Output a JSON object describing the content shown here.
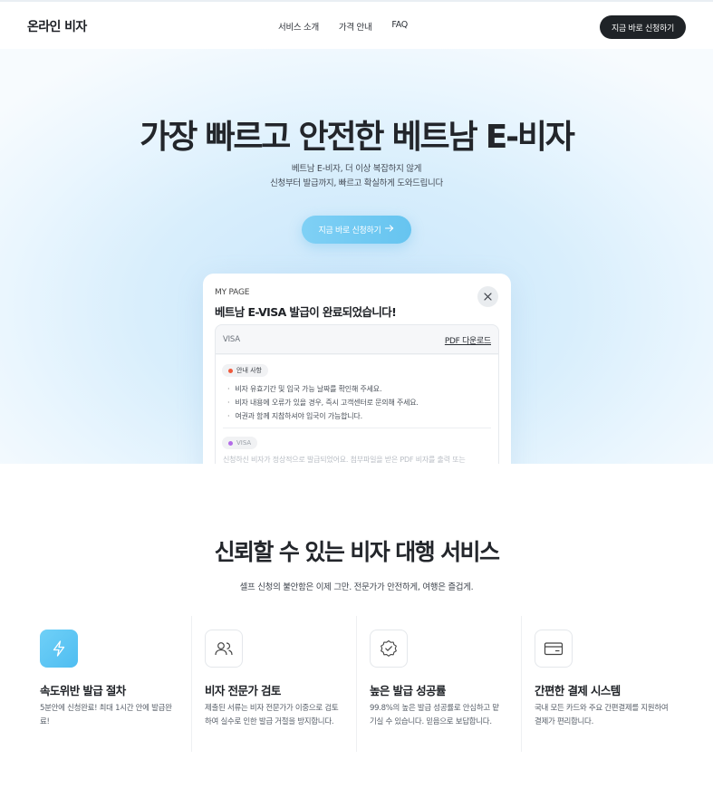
{
  "header": {
    "logo": "온라인 비자",
    "nav": [
      "서비스 소개",
      "가격 안내",
      "FAQ"
    ],
    "cta": "지금 바로 신청하기"
  },
  "hero": {
    "title": "가장 빠르고 안전한 베트남 E-비자",
    "subtitle_line1": "베트남 E-비자, 더 이상 복잡하지 않게",
    "subtitle_line2": "신청부터 발급까지, 빠르고 확실하게 도와드립니다",
    "cta": "지금 바로 신청하기",
    "cta_icon": "arrow-right-icon"
  },
  "card": {
    "eyebrow": "MY PAGE",
    "title": "베트남 E-VISA 발급이 완료되었습니다!",
    "close_icon": "close-icon",
    "visa_label": "VISA",
    "pdf_link": "PDF 다운로드",
    "notice_badge": "안내 사항",
    "notices": [
      "비자 유효기간 및 입국 가능 날짜를 확인해 주세요.",
      "비자 내용에 오류가 있을 경우, 즉시 고객센터로 문의해 주세요.",
      "여권과 함께 지참하셔야 입국이 가능합니다."
    ],
    "visa_badge": "VISA",
    "visa_note": "신청하신 비자가 정상적으로 발급되었어요. 첨부파일을 받은 PDF 비자를 출력 또는"
  },
  "section2": {
    "title": "신뢰할 수 있는 비자 대행 서비스",
    "subtitle": "셀프 신청의 불안함은 이제 그만. 전문가가 안전하게, 여행은 즐겁게.",
    "features": [
      {
        "icon": "lightning-icon",
        "title": "속도위반 발급 절차",
        "desc": "5분안에 신청완료! 최대 1시간 안에 발급완료!"
      },
      {
        "icon": "users-icon",
        "title": "비자 전문가 검토",
        "desc": "제출된 서류는 비자 전문가가 이중으로 검토하여 실수로 인한 발급 거절을 방지합니다."
      },
      {
        "icon": "verified-badge-icon",
        "title": "높은 발급 성공률",
        "desc": "99.8%의 높은 발급 성공률로 안심하고 맡기실 수 있습니다. 믿음으로 보답합니다."
      },
      {
        "icon": "credit-card-icon",
        "title": "간편한 결제 시스템",
        "desc": "국내 모든 카드와 주요 간편결제를 지원하여 결제가 편리합니다."
      }
    ]
  },
  "colors": {
    "accent": "#66c4f0",
    "dark_button": "#1f2327",
    "notice_dot": "#ef5a3c",
    "visa_dot": "#b36be8"
  }
}
